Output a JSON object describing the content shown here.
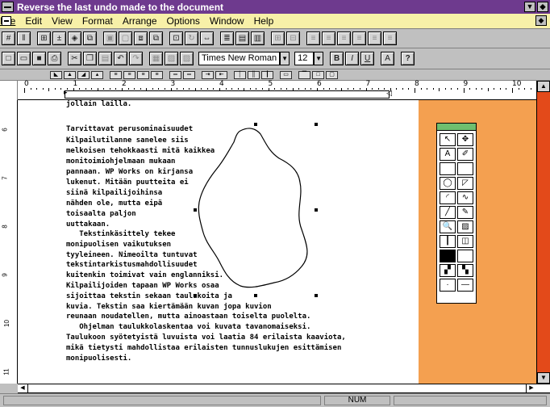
{
  "window": {
    "title": "Reverse the last undo made to the document"
  },
  "menus": [
    "File",
    "Edit",
    "View",
    "Format",
    "Arrange",
    "Options",
    "Window",
    "Help"
  ],
  "toolbar2": {
    "font_name": "Times New Roman",
    "font_size": "12",
    "bold_label": "B",
    "italic_label": "I",
    "underline_label": "U",
    "help_label": "?"
  },
  "ruler": {
    "numbers": [
      "0",
      "1",
      "2",
      "3",
      "4",
      "5",
      "6",
      "7",
      "8",
      "9",
      "10"
    ]
  },
  "vruler": {
    "numbers": [
      "6",
      "7",
      "8",
      "9",
      "10",
      "11"
    ]
  },
  "document": {
    "lines": [
      "jollain lailla.",
      "",
      "Tarvittavat perusominaisuudet",
      "Kilpailutilanne sanelee siis",
      "melkoisen tehokkaasti mitä kaikkea",
      "monitoimiohjelmaan mukaan",
      "pannaan. WP Works on kirjansa",
      "lukenut. Mitään puutteita ei",
      "siinä kilpailijoihinsa",
      "nähden ole, mutta eipä",
      "toisaalta paljon",
      "uuttakaan.",
      "   Tekstinkäsittely tekee",
      "monipuolisen vaikutuksen",
      "tyyleineen. Nimeoilta tuntuvat",
      "tekstintarkistusmahdollisuudet",
      "kuitenkin toimivat vain englanniksi.",
      "Kilpailijoiden tapaan WP Works osaa",
      "sijoittaa tekstin sekaan taulukoita ja",
      "kuvia. Tekstin saa kiertämään kuvan jopa kuvion",
      "reunaan noudatellen, mutta ainoastaan toiselta puolelta.",
      "   Ohjelman taulukkolaskentaa voi kuvata tavanomaiseksi.",
      "Taulukoon syötetyistä luvuista voi laatia 84 erilaista kaaviota,",
      "mikä tietysti mahdollistaa erilaisten tunnuslukujen esittämisen",
      "monipuolisesti."
    ]
  },
  "palette": {
    "tools": [
      {
        "name": "pointer-tool",
        "glyph": "↖"
      },
      {
        "name": "move-tool",
        "glyph": "✥"
      },
      {
        "name": "text-tool",
        "glyph": "A"
      },
      {
        "name": "color-tool",
        "glyph": "✐"
      },
      {
        "name": "rectangle-tool",
        "glyph": ""
      },
      {
        "name": "rounded-rectangle-tool",
        "glyph": ""
      },
      {
        "name": "ellipse-tool",
        "glyph": "◯"
      },
      {
        "name": "polygon-tool",
        "glyph": "◸"
      },
      {
        "name": "arc-tool",
        "glyph": "◜"
      },
      {
        "name": "freeform-tool",
        "glyph": "∿"
      },
      {
        "name": "line-tool",
        "glyph": "╱"
      },
      {
        "name": "pen-tool",
        "glyph": "✎"
      },
      {
        "name": "zoom-tool",
        "glyph": "🔍"
      },
      {
        "name": "crop-tool",
        "glyph": "▨"
      },
      {
        "name": "line-width-tool",
        "glyph": "┃"
      },
      {
        "name": "fill-tool",
        "glyph": "◫"
      },
      {
        "name": "black-swatch",
        "glyph": ""
      },
      {
        "name": "white-swatch",
        "glyph": ""
      },
      {
        "name": "pattern-swatch-1",
        "glyph": "▞"
      },
      {
        "name": "pattern-swatch-2",
        "glyph": "▚"
      },
      {
        "name": "line-style-1",
        "glyph": "·"
      },
      {
        "name": "line-style-2",
        "glyph": "—"
      }
    ]
  },
  "status": {
    "num_indicator": "NUM"
  },
  "colors": {
    "titlebar": "#6e3a8e",
    "menubar": "#f7f0a8",
    "side_panel": "#f4a050",
    "scrollbar": "#e34a1a",
    "palette_title": "#6fbf6f"
  }
}
